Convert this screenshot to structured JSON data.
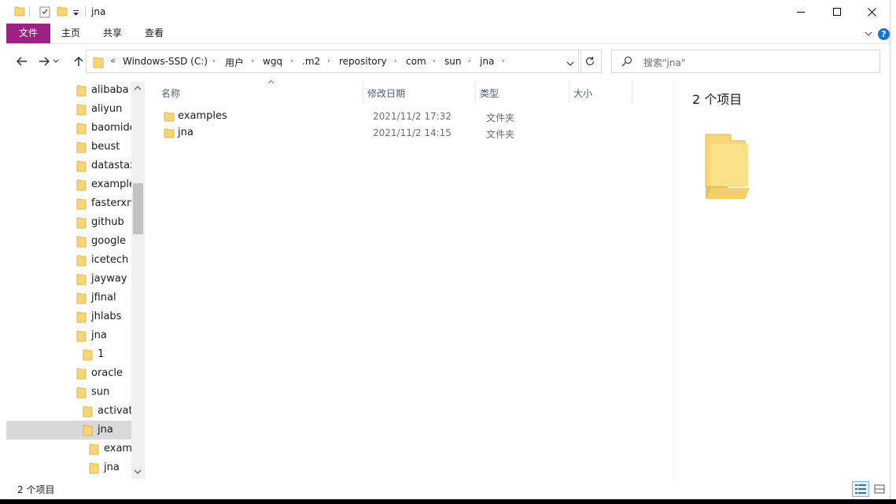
{
  "window": {
    "title": "jna"
  },
  "ribbon": {
    "tabs": [
      "文件",
      "主页",
      "共享",
      "查看"
    ],
    "help": "?"
  },
  "address": {
    "overflow": "«",
    "crumbs": [
      "Windows-SSD (C:)",
      "用户",
      "wgq",
      ".m2",
      "repository",
      "com",
      "sun",
      "jna"
    ]
  },
  "search": {
    "placeholder": "搜索\"jna\""
  },
  "tree": {
    "items": [
      {
        "label": "alibaba",
        "level": 0
      },
      {
        "label": "aliyun",
        "level": 0
      },
      {
        "label": "baomidou",
        "level": 0
      },
      {
        "label": "beust",
        "level": 0
      },
      {
        "label": "datastax",
        "level": 0
      },
      {
        "label": "example",
        "level": 0
      },
      {
        "label": "fasterxml",
        "level": 0
      },
      {
        "label": "github",
        "level": 0
      },
      {
        "label": "google",
        "level": 0
      },
      {
        "label": "icetech",
        "level": 0
      },
      {
        "label": "jayway",
        "level": 0
      },
      {
        "label": "jfinal",
        "level": 0
      },
      {
        "label": "jhlabs",
        "level": 0
      },
      {
        "label": "jna",
        "level": 0
      },
      {
        "label": "1",
        "level": 1
      },
      {
        "label": "oracle",
        "level": 0
      },
      {
        "label": "sun",
        "level": 0
      },
      {
        "label": "activation",
        "level": 1
      },
      {
        "label": "jna",
        "level": 1,
        "selected": true
      },
      {
        "label": "examples",
        "level": 2
      },
      {
        "label": "jna",
        "level": 2
      }
    ]
  },
  "columns": {
    "name": "名称",
    "date": "修改日期",
    "type": "类型",
    "size": "大小"
  },
  "files": [
    {
      "name": "examples",
      "date": "2021/11/2 17:32",
      "type": "文件夹"
    },
    {
      "name": "jna",
      "date": "2021/11/2 14:15",
      "type": "文件夹"
    }
  ],
  "details": {
    "count": "2 个项目"
  },
  "status": {
    "count": "2 个项目"
  },
  "colors": {
    "file_tab": "#a01f83",
    "folder": "#f7d774",
    "selected": "#d9d9d9"
  }
}
